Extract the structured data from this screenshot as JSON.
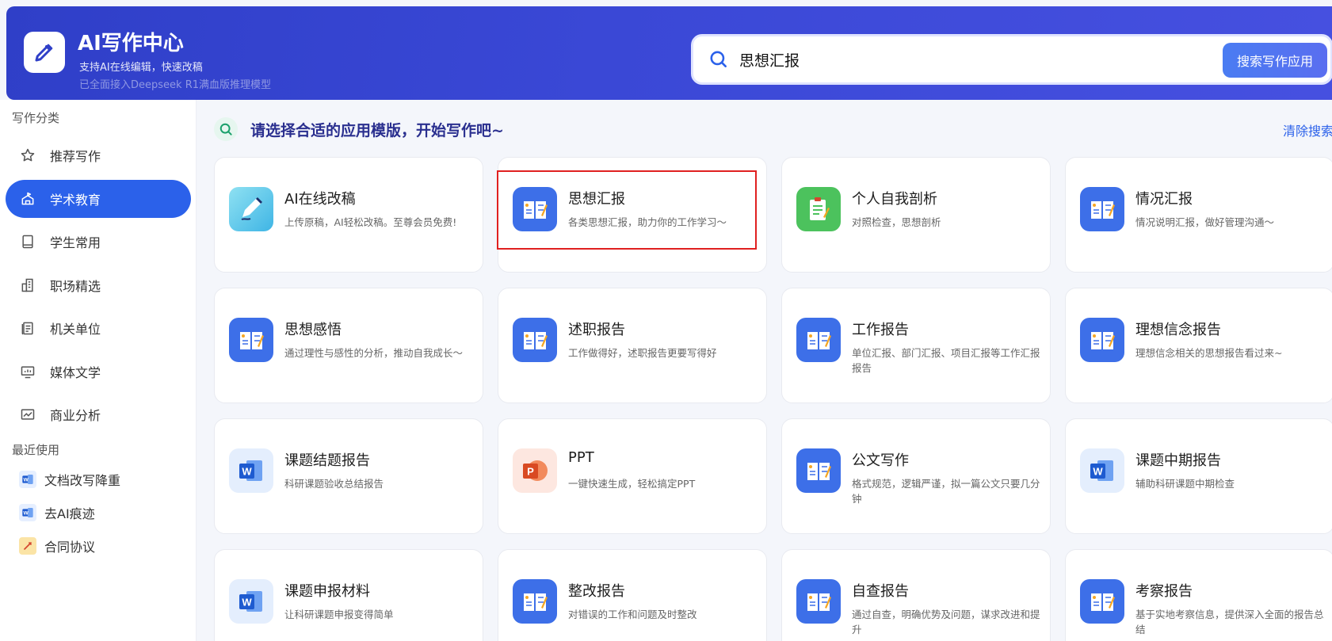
{
  "header": {
    "title": "AI写作中心",
    "subtitle": "支持AI在线编辑，快速改稿",
    "subtitle2": "已全面接入Deepseek R1满血版推理模型",
    "search": {
      "value": "思想汇报",
      "button_label": "搜索写作应用"
    }
  },
  "sidebar": {
    "category_label": "写作分类",
    "items": [
      {
        "label": "推荐写作",
        "icon": "star-icon"
      },
      {
        "label": "学术教育",
        "icon": "academic-icon",
        "active": true
      },
      {
        "label": "学生常用",
        "icon": "book-icon"
      },
      {
        "label": "职场精选",
        "icon": "building-icon"
      },
      {
        "label": "机关单位",
        "icon": "document-icon"
      },
      {
        "label": "媒体文学",
        "icon": "media-icon"
      },
      {
        "label": "商业分析",
        "icon": "chart-icon"
      }
    ],
    "recent_label": "最近使用",
    "recent": [
      {
        "label": "文档改写降重",
        "icon": "word-icon"
      },
      {
        "label": "去AI痕迹",
        "icon": "word-icon"
      },
      {
        "label": "合同协议",
        "icon": "pen-icon"
      }
    ]
  },
  "main": {
    "title": "请选择合适的应用模版，开始写作吧~",
    "clear_label": "清除搜索",
    "cards": [
      {
        "title": "AI在线改稿",
        "desc": "上传原稿，AI轻松改稿。至尊会员免费!",
        "icon": "pen-icon"
      },
      {
        "title": "思想汇报",
        "desc": "各类思想汇报，助力你的工作学习～",
        "icon": "notebook-icon"
      },
      {
        "title": "个人自我剖析",
        "desc": "对照检查，思想剖析",
        "icon": "clipboard-icon"
      },
      {
        "title": "情况汇报",
        "desc": "情况说明汇报，做好管理沟通～",
        "icon": "notebook-icon"
      },
      {
        "title": "思想感悟",
        "desc": "通过理性与感性的分析，推动自我成长～",
        "icon": "notebook-icon"
      },
      {
        "title": "述职报告",
        "desc": "工作做得好，述职报告更要写得好",
        "icon": "notebook-icon"
      },
      {
        "title": "工作报告",
        "desc": "单位汇报、部门汇报、项目汇报等工作汇报报告",
        "icon": "notebook-icon"
      },
      {
        "title": "理想信念报告",
        "desc": "理想信念相关的思想报告看过来~",
        "icon": "notebook-icon"
      },
      {
        "title": "课题结题报告",
        "desc": "科研课题验收总结报告",
        "icon": "word-icon"
      },
      {
        "title": "PPT",
        "desc": "一键快速生成，轻松搞定PPT",
        "icon": "ppt-icon"
      },
      {
        "title": "公文写作",
        "desc": "格式规范，逻辑严谨，拟一篇公文只要几分钟",
        "icon": "notebook-icon"
      },
      {
        "title": "课题中期报告",
        "desc": "辅助科研课题中期检查",
        "icon": "word-icon"
      },
      {
        "title": "课题申报材料",
        "desc": "让科研课题申报变得简单",
        "icon": "word-icon"
      },
      {
        "title": "整改报告",
        "desc": "对错误的工作和问题及时整改",
        "icon": "notebook-icon"
      },
      {
        "title": "自查报告",
        "desc": "通过自查，明确优势及问题，谋求改进和提升",
        "icon": "notebook-icon"
      },
      {
        "title": "考察报告",
        "desc": "基于实地考察信息，提供深入全面的报告总结",
        "icon": "notebook-icon"
      }
    ]
  },
  "colors": {
    "primary": "#2b61ea",
    "header_start": "#2f3fc8",
    "header_end": "#4650e0",
    "highlight": "#e02020"
  }
}
